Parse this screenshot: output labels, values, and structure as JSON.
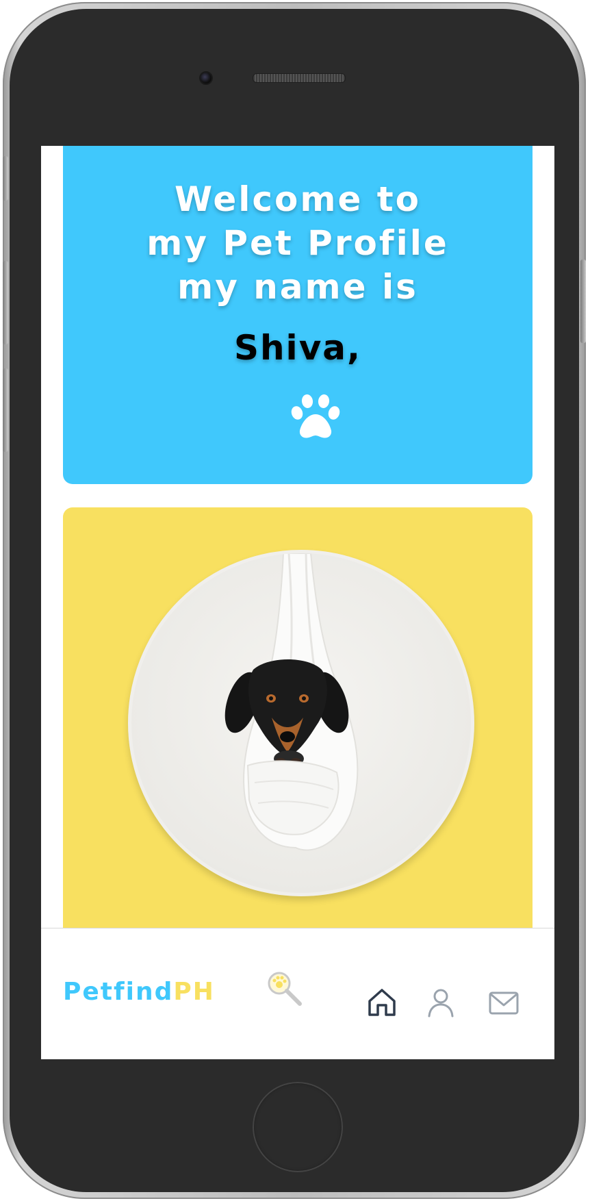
{
  "welcome": {
    "line1": "Welcome to",
    "line2": "my Pet Profile",
    "line3": "my name is",
    "pet_name": "Shiva,"
  },
  "icons": {
    "paw": "paw-icon",
    "home": "home-icon",
    "profile": "user-icon",
    "mail": "mail-icon",
    "search": "magnifier-paw-icon"
  },
  "photo": {
    "alt": "dog-photo"
  },
  "brand": {
    "pet": "Petfind",
    "ph": "PH"
  },
  "colors": {
    "blue": "#40c8fc",
    "yellow": "#f8e060",
    "active_icon": "#2f3b4c",
    "inactive_icon": "#9aa3ad"
  }
}
